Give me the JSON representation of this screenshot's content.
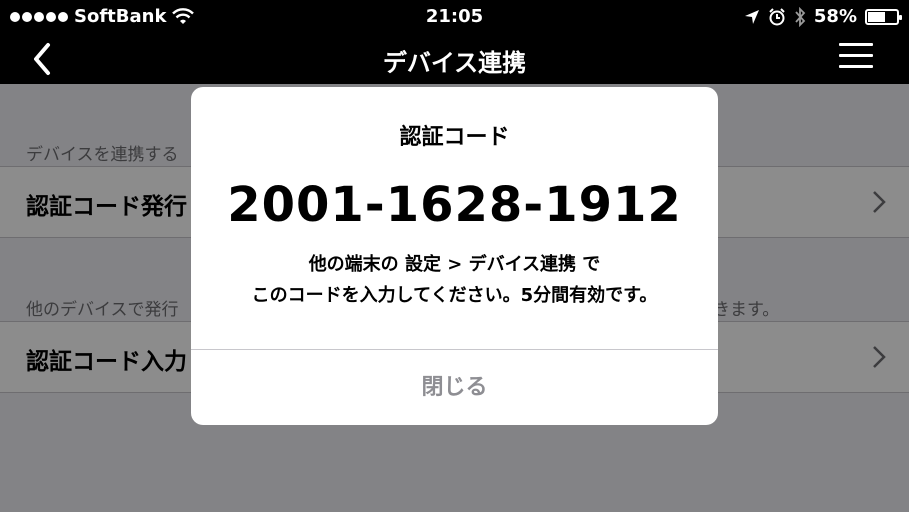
{
  "status_bar": {
    "carrier": "SoftBank",
    "time": "21:05",
    "battery": "58%",
    "battery_level": 0.58
  },
  "nav": {
    "title": "デバイス連携",
    "back_icon": "chevron-left-icon",
    "menu_icon": "hamburger-menu-icon"
  },
  "page": {
    "section1_header": "デバイスを連携する",
    "issue_code_label": "認証コード発行",
    "section2_header": "他のデバイスで発行",
    "section2_header_tail": "きます。",
    "enter_code_label": "認証コード入力"
  },
  "alert": {
    "title": "認証コード",
    "code": "2001-1628-1912",
    "message_line1": "他の端末の 設定 > デバイス連携 で",
    "message_line2": "このコードを入力してください。5分間有効です。",
    "close_label": "閉じる"
  },
  "colors": {
    "header_bg": "#000000",
    "overlay": "rgba(0,0,0,0.45)",
    "close_text": "#8e8e93"
  }
}
